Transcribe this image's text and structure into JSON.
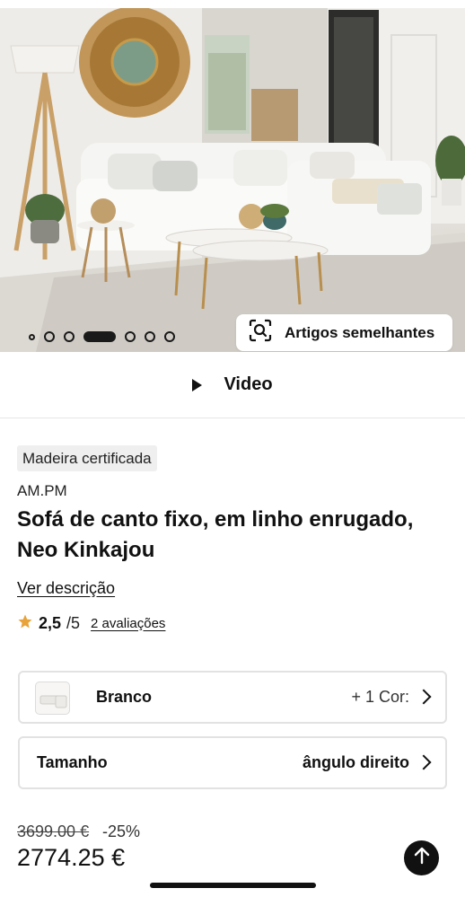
{
  "gallery": {
    "total_images": 7,
    "active_index": 3,
    "similar_button_label": "Artigos semelhantes"
  },
  "video": {
    "label": "Video"
  },
  "product": {
    "badge": "Madeira certificada",
    "brand": "AM.PM",
    "title": "Sofá de canto fixo, em linho enrugado, Neo Kinkajou",
    "description_link": "Ver descrição",
    "rating": {
      "score": "2,5",
      "out_of": "/5",
      "reviews_link": "2 avaliações",
      "stars_shown": 1
    }
  },
  "options": {
    "color": {
      "value": "Branco",
      "more": "+ 1 Cor:"
    },
    "size": {
      "label": "Tamanho",
      "value": "ângulo direito"
    }
  },
  "price": {
    "old": "3699.00 €",
    "discount": "-25%",
    "current": "2774.25 €"
  },
  "colors": {
    "accent": "#111111",
    "star": "#e8a33a",
    "badge_bg": "#efefef"
  },
  "icons": [
    "visual-search-icon",
    "play-icon",
    "star-icon",
    "chevron-right-icon",
    "arrow-up-icon"
  ]
}
